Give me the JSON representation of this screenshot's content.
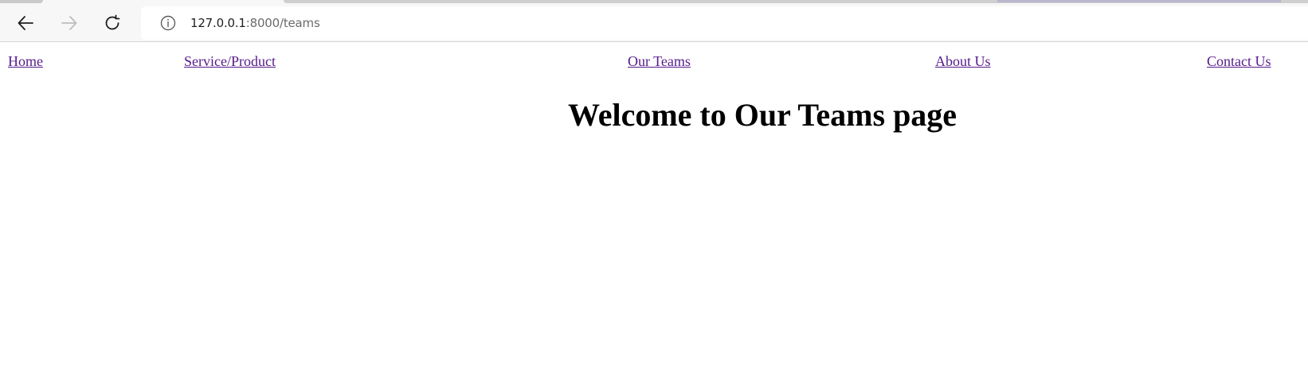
{
  "browser": {
    "url_host": "127.0.0.1",
    "url_path": ":8000/teams",
    "icons": {
      "back": "arrow-left-icon",
      "forward": "arrow-right-icon",
      "reload": "reload-icon",
      "site_info": "info-icon"
    }
  },
  "nav": {
    "items": [
      {
        "label": "Home"
      },
      {
        "label": "Service/Product"
      },
      {
        "label": "Our Teams"
      },
      {
        "label": "About Us"
      },
      {
        "label": "Contact Us"
      }
    ],
    "link_color": "#551a8b"
  },
  "main": {
    "title": "Welcome to Our Teams page"
  }
}
